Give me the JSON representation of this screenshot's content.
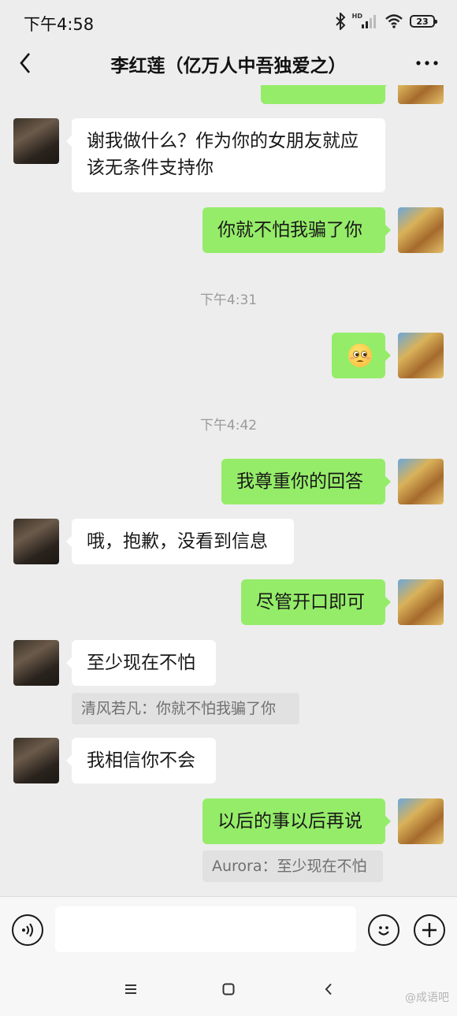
{
  "status": {
    "time": "下午4:58",
    "hd": "HD",
    "battery": "23"
  },
  "header": {
    "title": "李红莲（亿万人中吾独爱之）"
  },
  "messages": {
    "m1": "谢我做什么？作为你的女朋友就应该无条件支持你",
    "m2": "你就不怕我骗了你",
    "t1": "下午4:31",
    "t2": "下午4:42",
    "m4": "我尊重你的回答",
    "m5": "哦，抱歉，没看到信息",
    "m6": "尽管开口即可",
    "m7": "至少现在不怕",
    "q7": "清风若凡：你就不怕我骗了你",
    "m8": "我相信你不会",
    "m9": "以后的事以后再说",
    "q9": "Aurora：至少现在不怕"
  },
  "input": {
    "placeholder": ""
  },
  "watermark": "@成语吧",
  "colors": {
    "background": "#ededed",
    "sent_bubble": "#95ec69",
    "received_bubble": "#ffffff"
  },
  "icons": [
    "bluetooth-icon",
    "signal-icon",
    "wifi-icon",
    "battery-icon",
    "back-arrow-icon",
    "more-icon",
    "voice-icon",
    "emoji-icon",
    "add-icon",
    "menu-nav-icon",
    "home-nav-icon",
    "back-nav-icon"
  ]
}
